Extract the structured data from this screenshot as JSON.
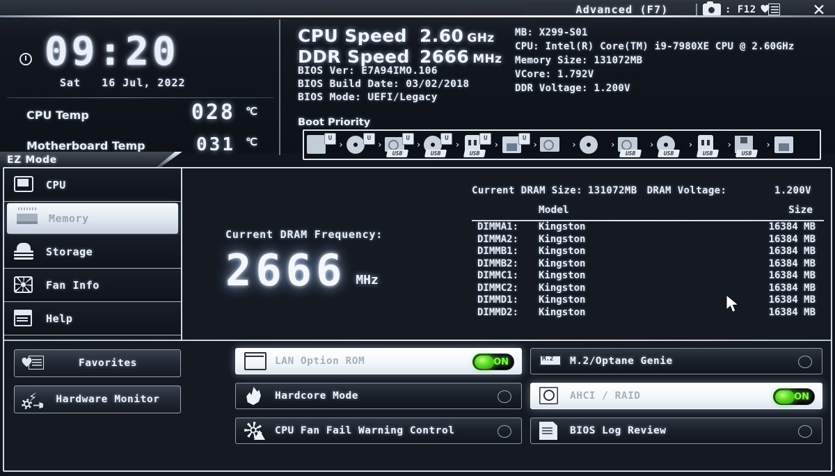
{
  "topbar": {
    "advanced_tab": "Advanced (F7)",
    "screenshot_key": ": F12",
    "camera_icon": "camera-icon",
    "favorites_icon": "favorites-list-icon",
    "close_icon": "close-icon"
  },
  "clock": {
    "time": "09:20",
    "weekday": "Sat",
    "date": "16 Jul, 2022",
    "clock_icon": "clock-icon",
    "cpu_temp_label": "CPU Temp",
    "cpu_temp_value": "028",
    "cpu_temp_unit": "℃",
    "mb_temp_label": "Motherboard Temp",
    "mb_temp_value": "031",
    "mb_temp_unit": "℃"
  },
  "speeds": {
    "cpu_label": "CPU Speed",
    "cpu_value": "2.60",
    "cpu_unit": "GHz",
    "ddr_label": "DDR Speed",
    "ddr_value": "2666",
    "ddr_unit": "MHz"
  },
  "bios": {
    "version_line": "BIOS Ver: E7A94IMO.106",
    "build_line": "BIOS Build Date: 03/02/2018",
    "mode_line": "BIOS Mode: UEFI/Legacy",
    "boot_priority_label": "Boot Priority"
  },
  "sysinfo": {
    "mb": "MB: X299-S01",
    "cpu": "CPU: Intel(R) Core(TM) i9-7980XE CPU @ 2.60GHz",
    "memory": "Memory Size: 131072MB",
    "vcore": "VCore: 1.792V",
    "ddr_voltage": "DDR Voltage: 1.200V"
  },
  "boot_devices": [
    {
      "icon": "hard-disk-uefi-icon",
      "tag": "U"
    },
    {
      "icon": "optical-disc-uefi-icon",
      "tag": "U"
    },
    {
      "icon": "usb-hard-disk-uefi-icon",
      "tag": "U"
    },
    {
      "icon": "usb-optical-uefi-icon",
      "tag": "U"
    },
    {
      "icon": "usb-key-uefi-icon",
      "tag": "U"
    },
    {
      "icon": "usb-lan-uefi-icon",
      "tag": "U"
    },
    {
      "icon": "hard-disk-icon",
      "tag": ""
    },
    {
      "icon": "optical-disc-icon",
      "tag": ""
    },
    {
      "icon": "usb-hard-disk-icon",
      "tag": ""
    },
    {
      "icon": "usb-optical-disc-icon",
      "tag": ""
    },
    {
      "icon": "usb-key-icon",
      "tag": ""
    },
    {
      "icon": "usb-floppy-icon",
      "tag": ""
    },
    {
      "icon": "lan-icon",
      "tag": ""
    }
  ],
  "ez_mode": {
    "tab_label": "EZ Mode"
  },
  "sidebar": {
    "items": [
      {
        "label": "CPU",
        "icon": "cpu-icon",
        "active": false
      },
      {
        "label": "Memory",
        "icon": "memory-icon",
        "active": true
      },
      {
        "label": "Storage",
        "icon": "storage-icon",
        "active": false
      },
      {
        "label": "Fan Info",
        "icon": "fan-icon",
        "active": false
      },
      {
        "label": "Help",
        "icon": "help-book-icon",
        "active": false
      }
    ]
  },
  "dram_frequency": {
    "label": "Current DRAM Frequency:",
    "value": "2666",
    "unit": "MHz"
  },
  "dram": {
    "size_label": "Current DRAM Size:",
    "size_value": "131072MB",
    "voltage_label": "DRAM Voltage:",
    "voltage_value": "1.200V",
    "col_model": "Model",
    "col_size": "Size",
    "rows": [
      {
        "slot": "DIMMA1:",
        "model": "Kingston",
        "size": "16384 MB"
      },
      {
        "slot": "DIMMA2:",
        "model": "Kingston",
        "size": "16384 MB"
      },
      {
        "slot": "DIMMB1:",
        "model": "Kingston",
        "size": "16384 MB"
      },
      {
        "slot": "DIMMB2:",
        "model": "Kingston",
        "size": "16384 MB"
      },
      {
        "slot": "DIMMC1:",
        "model": "Kingston",
        "size": "16384 MB"
      },
      {
        "slot": "DIMMC2:",
        "model": "Kingston",
        "size": "16384 MB"
      },
      {
        "slot": "DIMMD1:",
        "model": "Kingston",
        "size": "16384 MB"
      },
      {
        "slot": "DIMMD2:",
        "model": "Kingston",
        "size": "16384 MB"
      }
    ]
  },
  "left_buttons": [
    {
      "label": "Favorites",
      "icon": "favorites-icon"
    },
    {
      "label": "Hardware Monitor",
      "icon": "hardware-monitor-icon"
    }
  ],
  "toggles_left": [
    {
      "label": "LAN Option ROM",
      "icon": "lan-rom-icon",
      "state": "ON",
      "highlighted": true
    },
    {
      "label": "Hardcore Mode",
      "icon": "flame-icon",
      "state": "OFF",
      "highlighted": false
    },
    {
      "label": "CPU Fan Fail Warning Control",
      "icon": "fan-warning-icon",
      "state": "OFF",
      "highlighted": false
    }
  ],
  "toggles_right": [
    {
      "label": "M.2/Optane Genie",
      "icon": "m2-module-icon",
      "state": "OFF",
      "highlighted": false
    },
    {
      "label": "AHCI / RAID",
      "icon": "raid-disk-icon",
      "state": "ON",
      "highlighted": true
    },
    {
      "label": "BIOS Log Review",
      "icon": "log-document-icon",
      "state": "OFF",
      "highlighted": false
    }
  ],
  "colors": {
    "accent_green": "#57d722",
    "panel_border": "#cfd8e3",
    "background": "#141922",
    "text": "#eef3fa"
  },
  "cursor": {
    "icon": "mouse-pointer-icon"
  }
}
